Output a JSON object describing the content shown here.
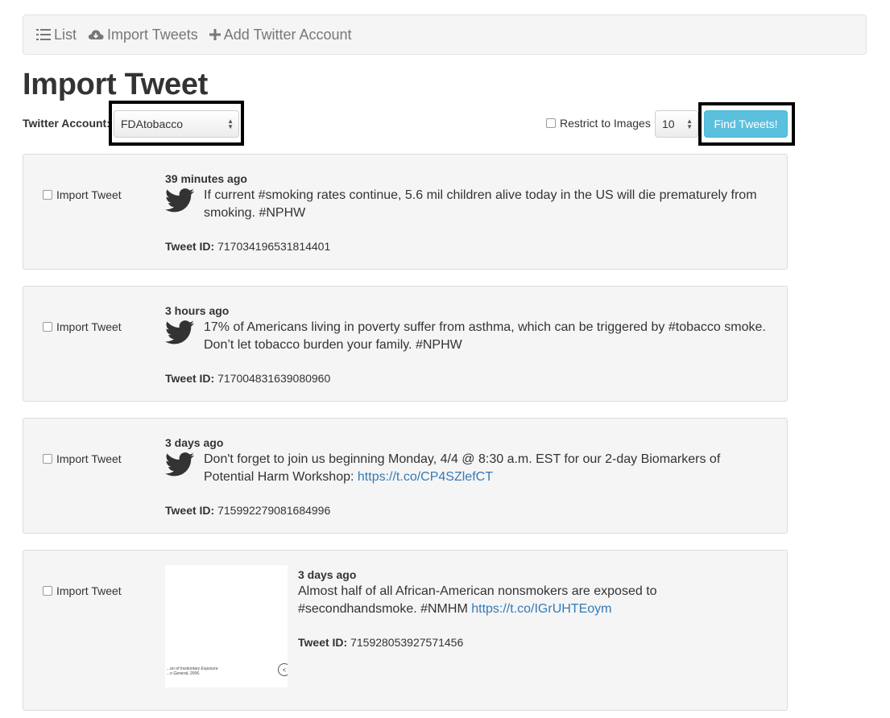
{
  "nav": {
    "list_label": "List",
    "import_label": "Import Tweets",
    "add_label": "Add Twitter Account"
  },
  "page_title": "Import Tweet",
  "form": {
    "account_label": "Twitter Account:",
    "account_value": "FDAtobacco",
    "restrict_label": "Restrict to Images",
    "count_value": "10",
    "find_label": "Find Tweets!"
  },
  "tweets": [
    {
      "import_label": "Import Tweet",
      "time": "39 minutes ago",
      "text": "If current #smoking rates continue, 5.6 mil children alive today in the US will die prematurely from smoking. #NPHW",
      "id_label": "Tweet ID:",
      "id": "717034196531814401"
    },
    {
      "import_label": "Import Tweet",
      "time": "3 hours ago",
      "text": "17% of Americans living in poverty suffer from asthma, which can be triggered by #tobacco smoke. Don’t let tobacco burden your family. #NPHW",
      "id_label": "Tweet ID:",
      "id": "717004831639080960"
    },
    {
      "import_label": "Import Tweet",
      "time": "3 days ago",
      "text": "Don't forget to join us beginning Monday, 4/4 @ 8:30 a.m. EST for our 2-day Biomarkers of Potential Harm Workshop:",
      "link": "https://t.co/CP4SZlefCT",
      "id_label": "Tweet ID:",
      "id": "715992279081684996"
    },
    {
      "import_label": "Import Tweet",
      "time": "3 days ago",
      "text": "Almost half of all African-American nonsmokers are exposed to #secondhandsmoke. #NMHM",
      "link": "https://t.co/IGrUHTEoym",
      "id_label": "Tweet ID:",
      "id": "715928053927571456",
      "image_caption_1": "...on of Involuntary Exposure",
      "image_caption_2": "...n General, 2006.",
      "image_icon": "<"
    }
  ],
  "colors": {
    "accent": "#5bc0de",
    "link": "#337ab7",
    "card_bg": "#f5f5f5"
  },
  "icons": {
    "list": "list-icon",
    "import": "cloud-download-icon",
    "add": "plus-icon",
    "tweet": "twitter-bird-icon"
  }
}
